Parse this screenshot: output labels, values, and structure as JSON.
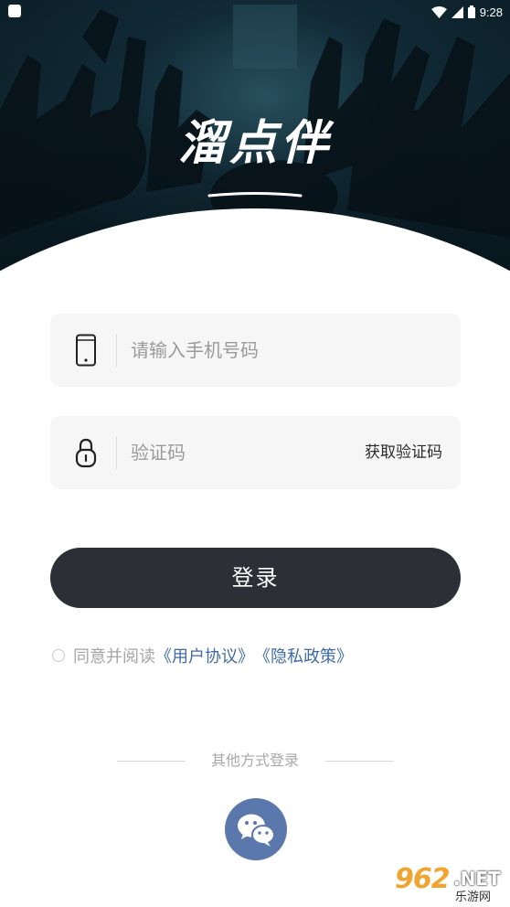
{
  "status_bar": {
    "time": "9:28",
    "icons": [
      "app-notification-icon",
      "wifi-icon",
      "signal-icon",
      "battery-icon"
    ]
  },
  "hero": {
    "logo": "溜点伴"
  },
  "phone_field": {
    "icon": "phone-icon",
    "placeholder": "请输入手机号码",
    "value": ""
  },
  "code_field": {
    "icon": "lock-icon",
    "placeholder": "验证码",
    "value": "",
    "get_code_label": "获取验证码"
  },
  "login_button": {
    "label": "登录"
  },
  "agreement": {
    "checked": false,
    "prefix": "同意并阅读",
    "user_agreement": "《用户协议》",
    "privacy_policy": "《隐私政策》"
  },
  "other_login": {
    "label": "其他方式登录",
    "wechat_icon": "wechat-icon"
  },
  "watermark": {
    "brand_number": "962",
    "brand_domain": ".NET",
    "brand_name": "乐游网"
  },
  "colors": {
    "login_button": "#2d2f36",
    "link": "#3f6aa6",
    "wechat": "#5b78ac",
    "field_bg": "#f6f6f6"
  }
}
